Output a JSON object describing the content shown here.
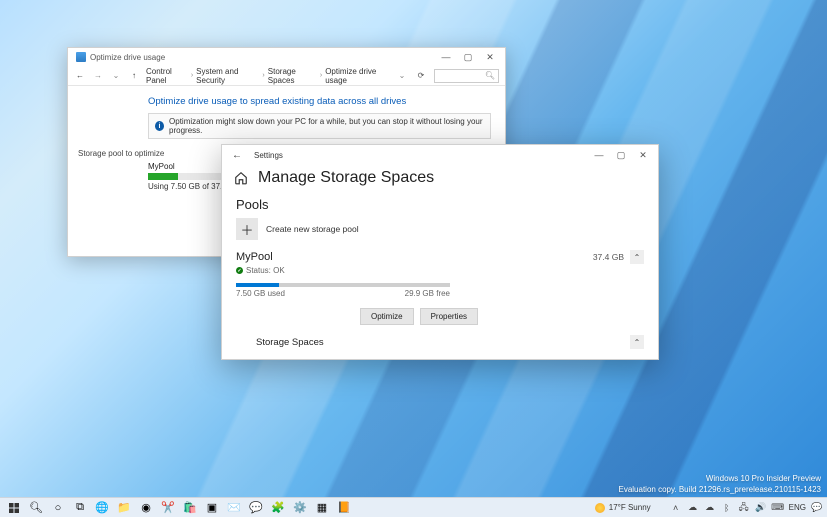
{
  "cp": {
    "title": "Optimize drive usage",
    "breadcrumbs": [
      "Control Panel",
      "System and Security",
      "Storage Spaces",
      "Optimize drive usage"
    ],
    "heading": "Optimize drive usage to spread existing data across all drives",
    "info": "Optimization might slow down your PC for a while, but you can stop it without losing your progress.",
    "section_label": "Storage pool to optimize",
    "pool_name": "MyPool",
    "usage_text": "Using 7.50 GB of 37.4 GB pool capacity"
  },
  "settings": {
    "title": "Settings",
    "heading": "Manage Storage Spaces",
    "pools_label": "Pools",
    "create_label": "Create new storage pool",
    "pool": {
      "name": "MyPool",
      "size": "37.4 GB",
      "status_text": "Status: OK",
      "used_text": "7.50 GB used",
      "free_text": "29.9 GB free"
    },
    "optimize_btn": "Optimize",
    "properties_btn": "Properties",
    "storage_spaces_label": "Storage Spaces"
  },
  "watermark": {
    "line1": "Windows 10 Pro Insider Preview",
    "line2": "Evaluation copy. Build 21296.rs_prerelease.210115-1423"
  },
  "taskbar": {
    "weather": "17°F Sunny",
    "lang": "ENG"
  },
  "colors": {
    "accent": "#0078d4",
    "green": "#107c10",
    "cp_blue": "#0a5db8"
  }
}
